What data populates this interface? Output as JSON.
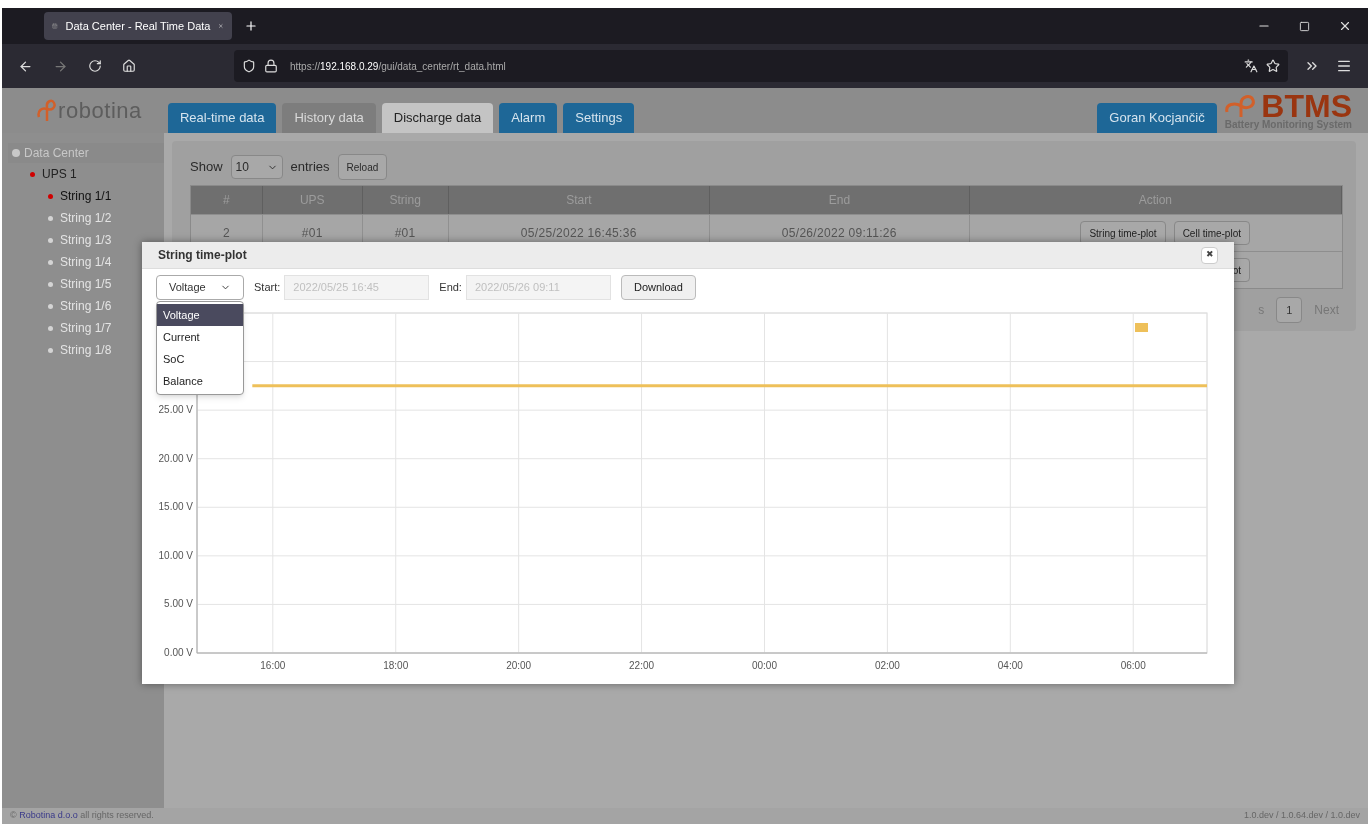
{
  "browser": {
    "tab_title": "Data Center - Real Time Data",
    "url": {
      "scheme": "https://",
      "host": "192.168.0.29",
      "path": "/gui/data_center/rt_data.html"
    }
  },
  "header": {
    "logo": "robotina",
    "tabs": [
      {
        "label": "Real-time data",
        "selected": false,
        "disabled": false
      },
      {
        "label": "History data",
        "selected": false,
        "disabled": true
      },
      {
        "label": "Discharge data",
        "selected": true,
        "disabled": false
      },
      {
        "label": "Alarm",
        "selected": false,
        "disabled": false
      },
      {
        "label": "Settings",
        "selected": false,
        "disabled": false
      }
    ],
    "user": "Goran Kocjančič",
    "brand": {
      "name": "BTMS",
      "tagline": "Battery Monitoring System"
    }
  },
  "sidebar": {
    "title": "Data Center",
    "items": [
      {
        "label": "UPS 1",
        "active": true,
        "children": [
          {
            "label": "String 1/1",
            "active": true
          },
          {
            "label": "String 1/2",
            "active": false
          },
          {
            "label": "String 1/3",
            "active": false
          },
          {
            "label": "String 1/4",
            "active": false
          },
          {
            "label": "String 1/5",
            "active": false
          },
          {
            "label": "String 1/6",
            "active": false
          },
          {
            "label": "String 1/7",
            "active": false
          },
          {
            "label": "String 1/8",
            "active": false
          }
        ]
      }
    ]
  },
  "table_controls": {
    "show_label": "Show",
    "page_size": "10",
    "entries_label": "entries",
    "reload": "Reload"
  },
  "table": {
    "columns": [
      "#",
      "UPS",
      "String",
      "Start",
      "End",
      "Action"
    ],
    "rows": [
      {
        "cells": [
          "2",
          "#01",
          "#01",
          "05/25/2022 16:45:36",
          "05/26/2022 09:11:26"
        ],
        "actions": [
          "String time-plot",
          "Cell time-plot"
        ]
      },
      {
        "cells": [],
        "actions": [
          "ot"
        ]
      }
    ]
  },
  "pagination": {
    "previous_partial": "s",
    "pages": [
      {
        "label": "1",
        "selected": true
      }
    ],
    "next": "Next"
  },
  "modal": {
    "title": "String time-plot",
    "close": "✖",
    "quantity": {
      "value": "Voltage",
      "options": [
        {
          "label": "Voltage",
          "selected": true
        },
        {
          "label": "Current",
          "selected": false
        },
        {
          "label": "SoC",
          "selected": false
        },
        {
          "label": "Balance",
          "selected": false
        }
      ]
    },
    "start_label": "Start:",
    "start_value": "2022/05/25 16:45",
    "end_label": "End:",
    "end_value": "2022/05/26 09:11",
    "download": "Download",
    "chart_data": {
      "type": "line",
      "grid": true,
      "x": [
        "2022-05-25T15:40",
        "2022-05-26T07:12"
      ],
      "series": [
        {
          "color": "#eec05a",
          "values": [
            27.5,
            27.5
          ]
        }
      ],
      "xlim": [
        "2022-05-25T14:46",
        "2022-05-26T07:12"
      ],
      "ylim": [
        0,
        35
      ],
      "xticks": [
        {
          "value": "2022-05-25T16:00",
          "label": "16:00"
        },
        {
          "value": "2022-05-25T18:00",
          "label": "18:00"
        },
        {
          "value": "2022-05-25T20:00",
          "label": "20:00"
        },
        {
          "value": "2022-05-25T22:00",
          "label": "22:00"
        },
        {
          "value": "2022-05-26T00:00",
          "label": "00:00"
        },
        {
          "value": "2022-05-26T02:00",
          "label": "02:00"
        },
        {
          "value": "2022-05-26T04:00",
          "label": "04:00"
        },
        {
          "value": "2022-05-26T06:00",
          "label": "06:00"
        }
      ],
      "yticks": [
        {
          "value": 0,
          "label": "0.00 V"
        },
        {
          "value": 5,
          "label": "5.00 V"
        },
        {
          "value": 10,
          "label": "10.00 V"
        },
        {
          "value": 15,
          "label": "15.00 V"
        },
        {
          "value": 20,
          "label": "20.00 V"
        },
        {
          "value": 25,
          "label": "25.00 V"
        }
      ]
    }
  },
  "footer": {
    "prefix": "©",
    "link": "Robotina d.o.o",
    "suffix": "all rights reserved.",
    "version": "1.0.dev / 1.0.64.dev / 1.0.dev"
  }
}
